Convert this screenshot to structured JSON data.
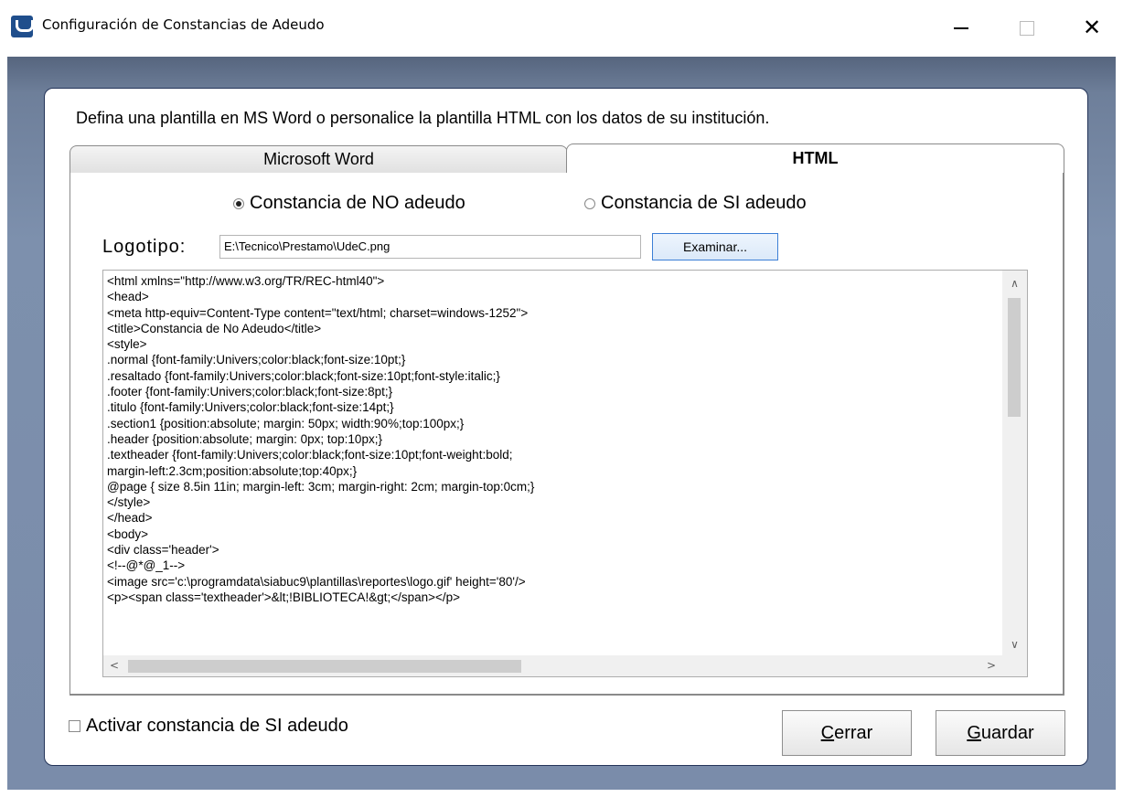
{
  "window": {
    "title": "Configuración de Constancias de Adeudo",
    "controls": {
      "minimize": "—",
      "maximize": "☐",
      "close": "✕"
    }
  },
  "instruction": "Defina una plantilla en MS Word o personalice la plantilla HTML con los datos de su institución.",
  "tabs": [
    {
      "label": "Microsoft Word",
      "selected": false
    },
    {
      "label": "HTML",
      "selected": true
    }
  ],
  "radios": [
    {
      "label": "Constancia de NO adeudo",
      "checked": true
    },
    {
      "label": "Constancia de SI adeudo",
      "checked": false
    }
  ],
  "logo": {
    "label": "Logotipo:",
    "value": "E:\\Tecnico\\Prestamo\\UdeC.png",
    "browse_label": "Examinar..."
  },
  "editor": {
    "lines": [
      "<html xmlns=\"http://www.w3.org/TR/REC-html40\">",
      "<head>",
      "<meta http-equiv=Content-Type content=\"text/html; charset=windows-1252\">",
      "<title>Constancia de No Adeudo</title>",
      "<style>",
      ".normal {font-family:Univers;color:black;font-size:10pt;}",
      ".resaltado {font-family:Univers;color:black;font-size:10pt;font-style:italic;}",
      ".footer {font-family:Univers;color:black;font-size:8pt;}",
      ".titulo {font-family:Univers;color:black;font-size:14pt;}",
      ".section1 {position:absolute; margin: 50px; width:90%;top:100px;}",
      ".header {position:absolute; margin: 0px; top:10px;}",
      ".textheader {font-family:Univers;color:black;font-size:10pt;font-weight:bold;",
      "margin-left:2.3cm;position:absolute;top:40px;}",
      "@page { size 8.5in 11in; margin-left: 3cm; margin-right: 2cm; margin-top:0cm;}",
      "</style>",
      "</head>",
      "<body>",
      "<div class='header'>",
      "<!--@*@_1-->",
      "<image src='c:\\programdata\\siabuc9\\plantillas\\reportes\\logo.gif' height='80'/>",
      "<p><span class='textheader'>&lt;!BIBLIOTECA!&gt;</span></p>"
    ]
  },
  "checkbox": {
    "label": "Activar constancia de SI adeudo",
    "checked": false
  },
  "buttons": {
    "close": {
      "accel": "C",
      "rest": "errar"
    },
    "save": {
      "accel": "G",
      "rest": "uardar"
    }
  },
  "colors": {
    "client_bg": "#7a8caa",
    "panel_border": "#243459",
    "browse_border": "#3c7fd6"
  }
}
